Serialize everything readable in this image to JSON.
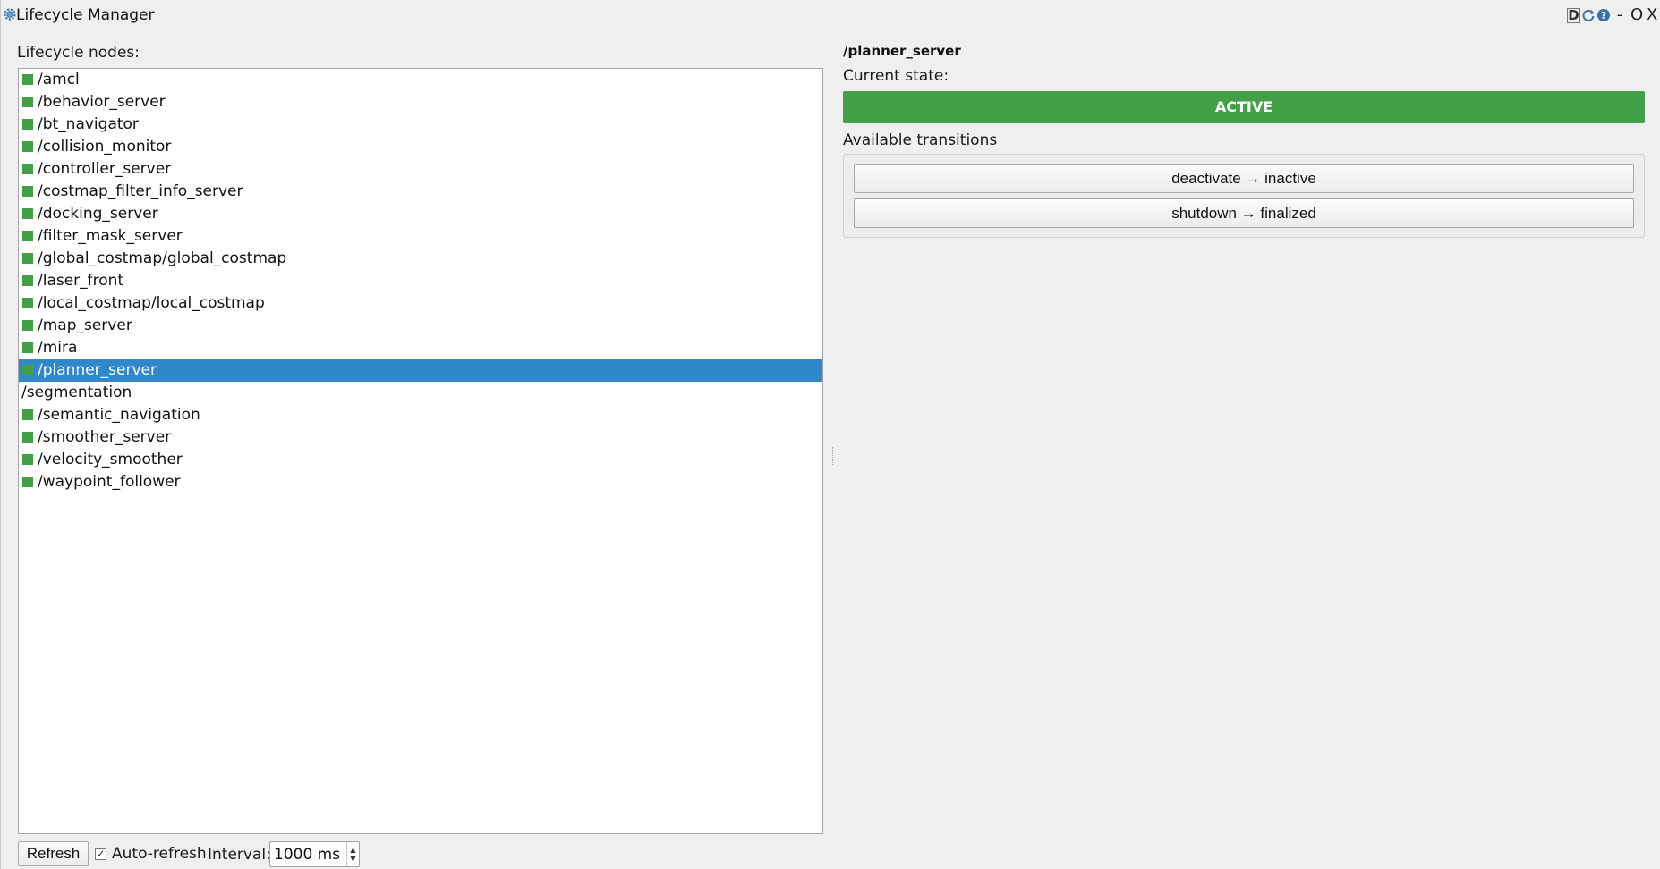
{
  "window": {
    "title": "Lifecycle Manager",
    "tool_d": "D",
    "minimize": "-",
    "maximize": "O",
    "close": "X"
  },
  "colors": {
    "active_green": "#43a046",
    "selection_blue": "#3087c9"
  },
  "left": {
    "label": "Lifecycle nodes:",
    "nodes": [
      {
        "name": "/amcl",
        "indicator": "green"
      },
      {
        "name": "/behavior_server",
        "indicator": "green"
      },
      {
        "name": "/bt_navigator",
        "indicator": "green"
      },
      {
        "name": "/collision_monitor",
        "indicator": "green"
      },
      {
        "name": "/controller_server",
        "indicator": "green"
      },
      {
        "name": "/costmap_filter_info_server",
        "indicator": "green"
      },
      {
        "name": "/docking_server",
        "indicator": "green"
      },
      {
        "name": "/filter_mask_server",
        "indicator": "green"
      },
      {
        "name": "/global_costmap/global_costmap",
        "indicator": "green"
      },
      {
        "name": "/laser_front",
        "indicator": "green"
      },
      {
        "name": "/local_costmap/local_costmap",
        "indicator": "green"
      },
      {
        "name": "/map_server",
        "indicator": "green"
      },
      {
        "name": "/mira",
        "indicator": "green"
      },
      {
        "name": "/planner_server",
        "indicator": "green",
        "selected": true
      },
      {
        "name": "/segmentation",
        "indicator": "none"
      },
      {
        "name": "/semantic_navigation",
        "indicator": "green"
      },
      {
        "name": "/smoother_server",
        "indicator": "green"
      },
      {
        "name": "/velocity_smoother",
        "indicator": "green"
      },
      {
        "name": "/waypoint_follower",
        "indicator": "green"
      }
    ]
  },
  "bottom": {
    "refresh_label": "Refresh",
    "auto_refresh_label": "Auto-refresh",
    "auto_refresh_checked": true,
    "interval_label": "Interval:",
    "interval_value": "1000 ms"
  },
  "right": {
    "node_title": "/planner_server",
    "current_state_label": "Current state:",
    "state": "ACTIVE",
    "transitions_label": "Available transitions",
    "transitions": [
      "deactivate → inactive",
      "shutdown → finalized"
    ]
  }
}
